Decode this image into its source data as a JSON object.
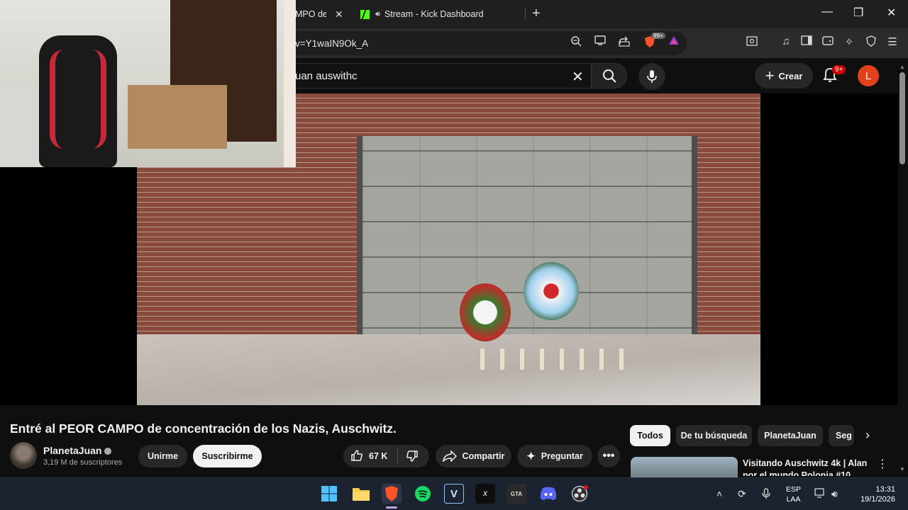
{
  "browser": {
    "tabs": [
      {
        "title": "MPO de",
        "truncated": true
      },
      {
        "title": "Stream - Kick Dashboard",
        "audio": true
      }
    ],
    "url_fragment": "v=Y1waIN9Ok_A",
    "brave_badge": "99+"
  },
  "youtube": {
    "search_query": "uan auswithc",
    "create_label": "Crear",
    "notifications_badge": "9+",
    "avatar_letter": "L",
    "video_title": "Entré al PEOR CAMPO de concentración de los Nazis, Auschwitz.",
    "channel_name": "PlanetaJuan",
    "subscribers": "3,19 M de suscriptores",
    "join_label": "Unirme",
    "subscribe_label": "Suscribirme",
    "likes": "67 K",
    "share_label": "Compartir",
    "ask_label": "Preguntar",
    "chips": [
      "Todos",
      "De tu búsqueda",
      "PlanetaJuan",
      "Seg"
    ],
    "recommendation_title": "Visitando Auschwitz 4k | Alan por el mundo Polonia #10"
  },
  "taskbar": {
    "lang": [
      "ESP",
      "LAA"
    ],
    "time": "13:31",
    "date": "19/1/2026"
  },
  "colors": {
    "accent_red": "#cc0000",
    "kick_green": "#53fc18",
    "avatar_orange": "#e1421b"
  }
}
